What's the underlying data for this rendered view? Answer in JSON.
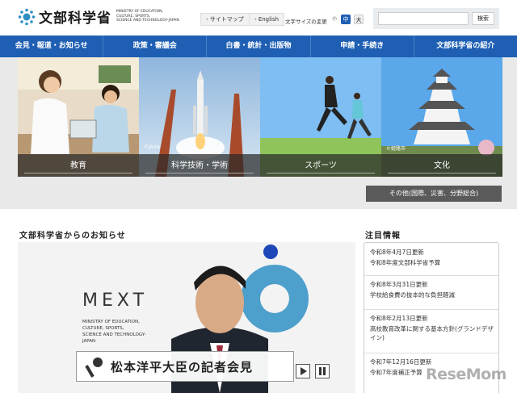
{
  "header": {
    "logo_text": "文部科学省",
    "logo_sub": [
      "MINISTRY OF EDUCATION,",
      "CULTURE, SPORTS,",
      "SCIENCE AND TECHNOLOGY-JAPAN"
    ],
    "sitemap": "サイトマップ",
    "english": "English",
    "fontsize_label": "文字サイズの変更",
    "fontsize_small": "小",
    "fontsize_mid": "中",
    "fontsize_large": "大",
    "search_button": "検索",
    "search_value": ""
  },
  "nav": [
    "会見・報道・お知らせ",
    "政策・審議会",
    "白書・統計・出版物",
    "申請・手続き",
    "文部科学省の紹介"
  ],
  "hero": {
    "tiles": [
      {
        "label": "教育"
      },
      {
        "label": "科学技術・学術",
        "credit": "©JAXA"
      },
      {
        "label": "スポーツ"
      },
      {
        "label": "文化",
        "credit": "©姫路市"
      }
    ],
    "other": "その他(国際、災害、分野総合)"
  },
  "news": {
    "title": "文部科学省からのお知らせ",
    "mext": "MEXT",
    "mext_sub": [
      "MINISTRY OF EDUCATION,",
      "CULTURE, SPORTS,",
      "SCIENCE AND TECHNOLOGY-JAPAN"
    ],
    "caption": "松本洋平大臣の記者会見"
  },
  "notices": {
    "title": "注目情報",
    "items": [
      {
        "date": "令和8年4月7日更新",
        "text": "令和8年度文部科学省予算"
      },
      {
        "date": "令和8年3月31日更新",
        "text": "学校給食費の抜本的な負担軽減"
      },
      {
        "date": "令和8年2月13日更新",
        "text": "高校教育改革に関する基本方針(グランドデザイン)"
      },
      {
        "date": "令和7年12月16日更新",
        "text": "令和7年度補正予算"
      }
    ]
  },
  "watermark": "ReseMom",
  "colors": {
    "nav": "#1e5fb4",
    "brand": "#2f8fc4"
  }
}
